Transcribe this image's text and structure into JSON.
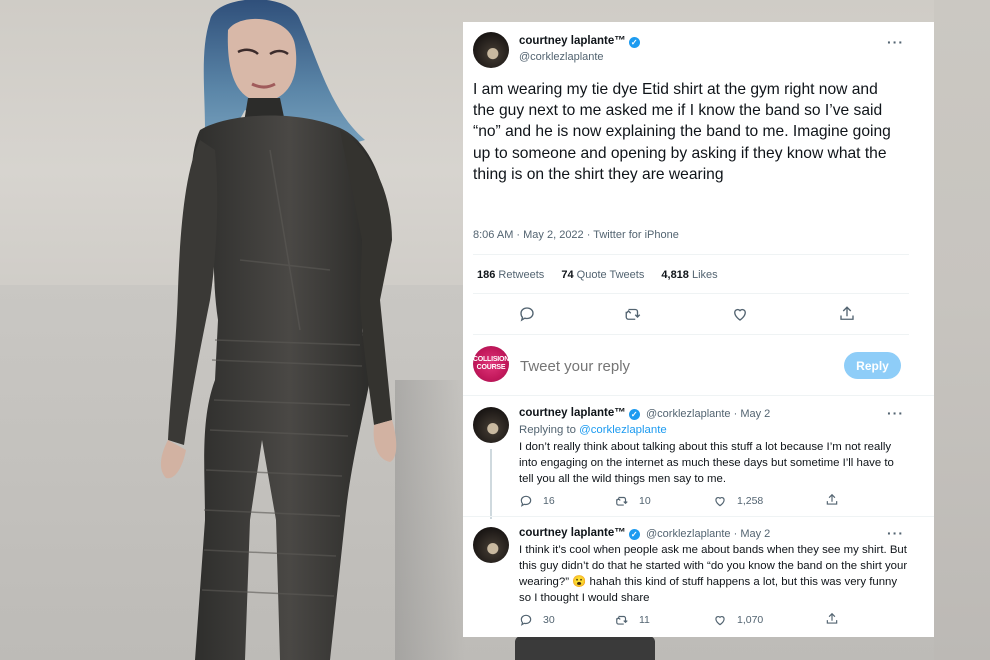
{
  "main_tweet": {
    "author_name": "courtney laplante™",
    "verified_mark": "✓",
    "handle": "@corklezlaplante",
    "more_label": "···",
    "text": "I am wearing my tie dye Etid shirt at the gym right now and the guy next to me asked me if I know the band so I’ve said “no” and he is now explaining the band to me. Imagine going up to someone and opening by asking if they know what the thing is on the shirt they are wearing",
    "timestamp": "8:06 AM · May 2, 2022 · Twitter for iPhone",
    "stats": {
      "retweets_count": "186",
      "retweets_label": "Retweets",
      "quotes_count": "74",
      "quotes_label": "Quote Tweets",
      "likes_count": "4,818",
      "likes_label": "Likes"
    }
  },
  "compose": {
    "avatar_text": "COLLISION COURSE",
    "placeholder": "Tweet your reply",
    "reply_button": "Reply"
  },
  "replies": [
    {
      "author_name": "courtney laplante™",
      "verified_mark": "✓",
      "handle": "@corklezlaplante · May 2",
      "more_label": "···",
      "replying_prefix": "Replying to ",
      "replying_to": "@corklezlaplante",
      "text": "I don’t really think about talking about this stuff a lot because I’m not really into engaging on the internet as much these days but sometime I’ll have to tell you all the wild things men say to me.",
      "replies_count": "16",
      "retweets_count": "10",
      "likes_count": "1,258"
    },
    {
      "author_name": "courtney laplante™",
      "verified_mark": "✓",
      "handle": "@corklezlaplante · May 2",
      "more_label": "···",
      "text": "I think it’s cool when people ask me about bands when they see my shirt. But this guy didn’t do that he started with “do you know the band on the shirt your wearing?” 😮 hahah this kind of stuff happens a lot, but this was very funny so I thought I would share",
      "replies_count": "30",
      "retweets_count": "11",
      "likes_count": "1,070"
    }
  ],
  "colors": {
    "accent": "#1d9bf0",
    "text_primary": "#0f1419",
    "text_secondary": "#536471",
    "reply_button_disabled": "#8ecdf8"
  },
  "icons": [
    "verified-icon",
    "more-icon",
    "reply-icon",
    "retweet-icon",
    "like-icon",
    "share-icon"
  ]
}
